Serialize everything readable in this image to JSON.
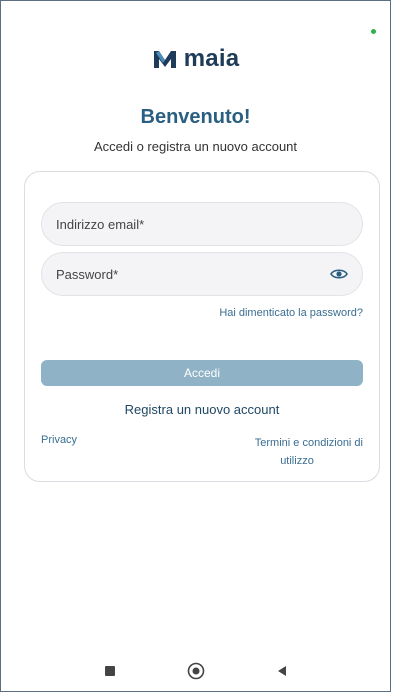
{
  "app": {
    "name": "maia",
    "logo_letter": "M",
    "brand_color": "#1f3b5a",
    "accent_color": "#2a5f82"
  },
  "header": {
    "welcome": "Benvenuto!",
    "subtitle": "Accedi o registra un nuovo account"
  },
  "form": {
    "email_placeholder": "Indirizzo email*",
    "password_placeholder": "Password*",
    "show_password_icon": "eye-icon",
    "forgot_password": "Hai dimenticato la password?",
    "login_button": "Accedi",
    "login_button_color": "#8fb2c6"
  },
  "links": {
    "register": "Registra un nuovo account",
    "privacy": "Privacy",
    "terms_line1": "Termini e condizioni di",
    "terms_line2": "utilizzo"
  },
  "system_nav": {
    "icons": [
      "square-icon",
      "circle-home-icon",
      "triangle-back-icon"
    ]
  }
}
